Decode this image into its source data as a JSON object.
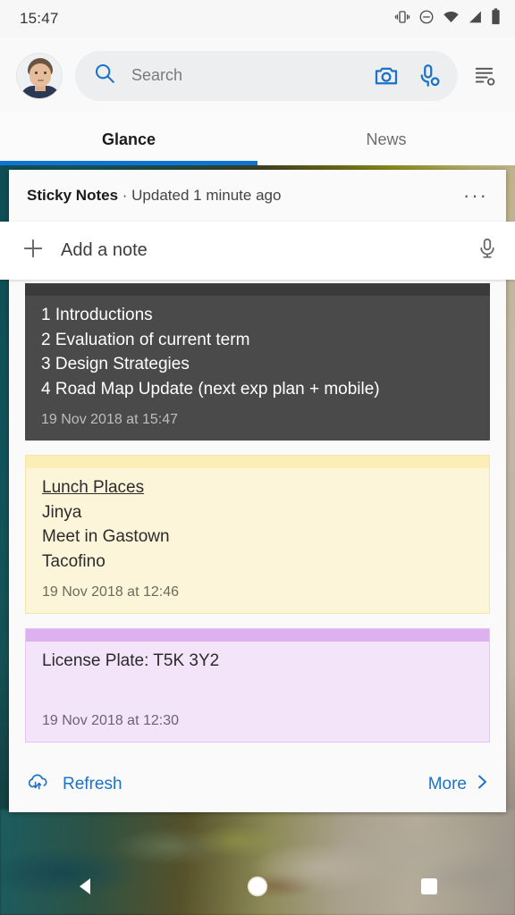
{
  "status_bar": {
    "time": "15:47",
    "icons": [
      "vibrate-icon",
      "do-not-disturb-icon",
      "wifi-icon",
      "cellular-signal-icon",
      "battery-icon"
    ]
  },
  "search": {
    "placeholder": "Search",
    "value": "",
    "search_icon": "search-icon",
    "camera_icon": "camera-icon",
    "voice_icon": "microphone-icon",
    "settings_icon": "settings-list-icon",
    "avatar": "user-avatar"
  },
  "tabs": [
    {
      "label": "Glance",
      "active": true
    },
    {
      "label": "News",
      "active": false
    }
  ],
  "widget": {
    "title": "Sticky Notes",
    "subtitle": " · Updated 1 minute ago",
    "overflow_label": "···",
    "add_note_label": "Add a note",
    "add_note_plus": "+",
    "add_note_mic_icon": "microphone-icon",
    "footer": {
      "refresh_label": "Refresh",
      "refresh_icon": "cloud-sync-icon",
      "more_label": "More",
      "more_icon": "chevron-right-icon"
    }
  },
  "notes": [
    {
      "color": "dark",
      "lines": [
        "1 Introductions",
        "2 Evaluation of current term",
        "3 Design Strategies",
        "4 Road Map Update (next exp plan + mobile)"
      ],
      "timestamp": "19 Nov 2018 at 15:47"
    },
    {
      "color": "yellow",
      "title": "Lunch Places",
      "lines": [
        "Jinya",
        "Meet in Gastown",
        "Tacofino"
      ],
      "timestamp": "19 Nov 2018 at 12:46"
    },
    {
      "color": "purple",
      "lines": [
        "License Plate: T5K 3Y2"
      ],
      "timestamp": "19 Nov 2018 at 12:30"
    }
  ],
  "nav_bar": {
    "back": "back-triangle-icon",
    "home": "home-circle-icon",
    "recents": "recents-square-icon"
  },
  "colors": {
    "accent_blue": "#0f74d4",
    "link_blue": "#1a73c8",
    "note_dark": "#4a4a4a",
    "note_yellow": "#fdf5da",
    "note_purple": "#f3e4fa"
  }
}
